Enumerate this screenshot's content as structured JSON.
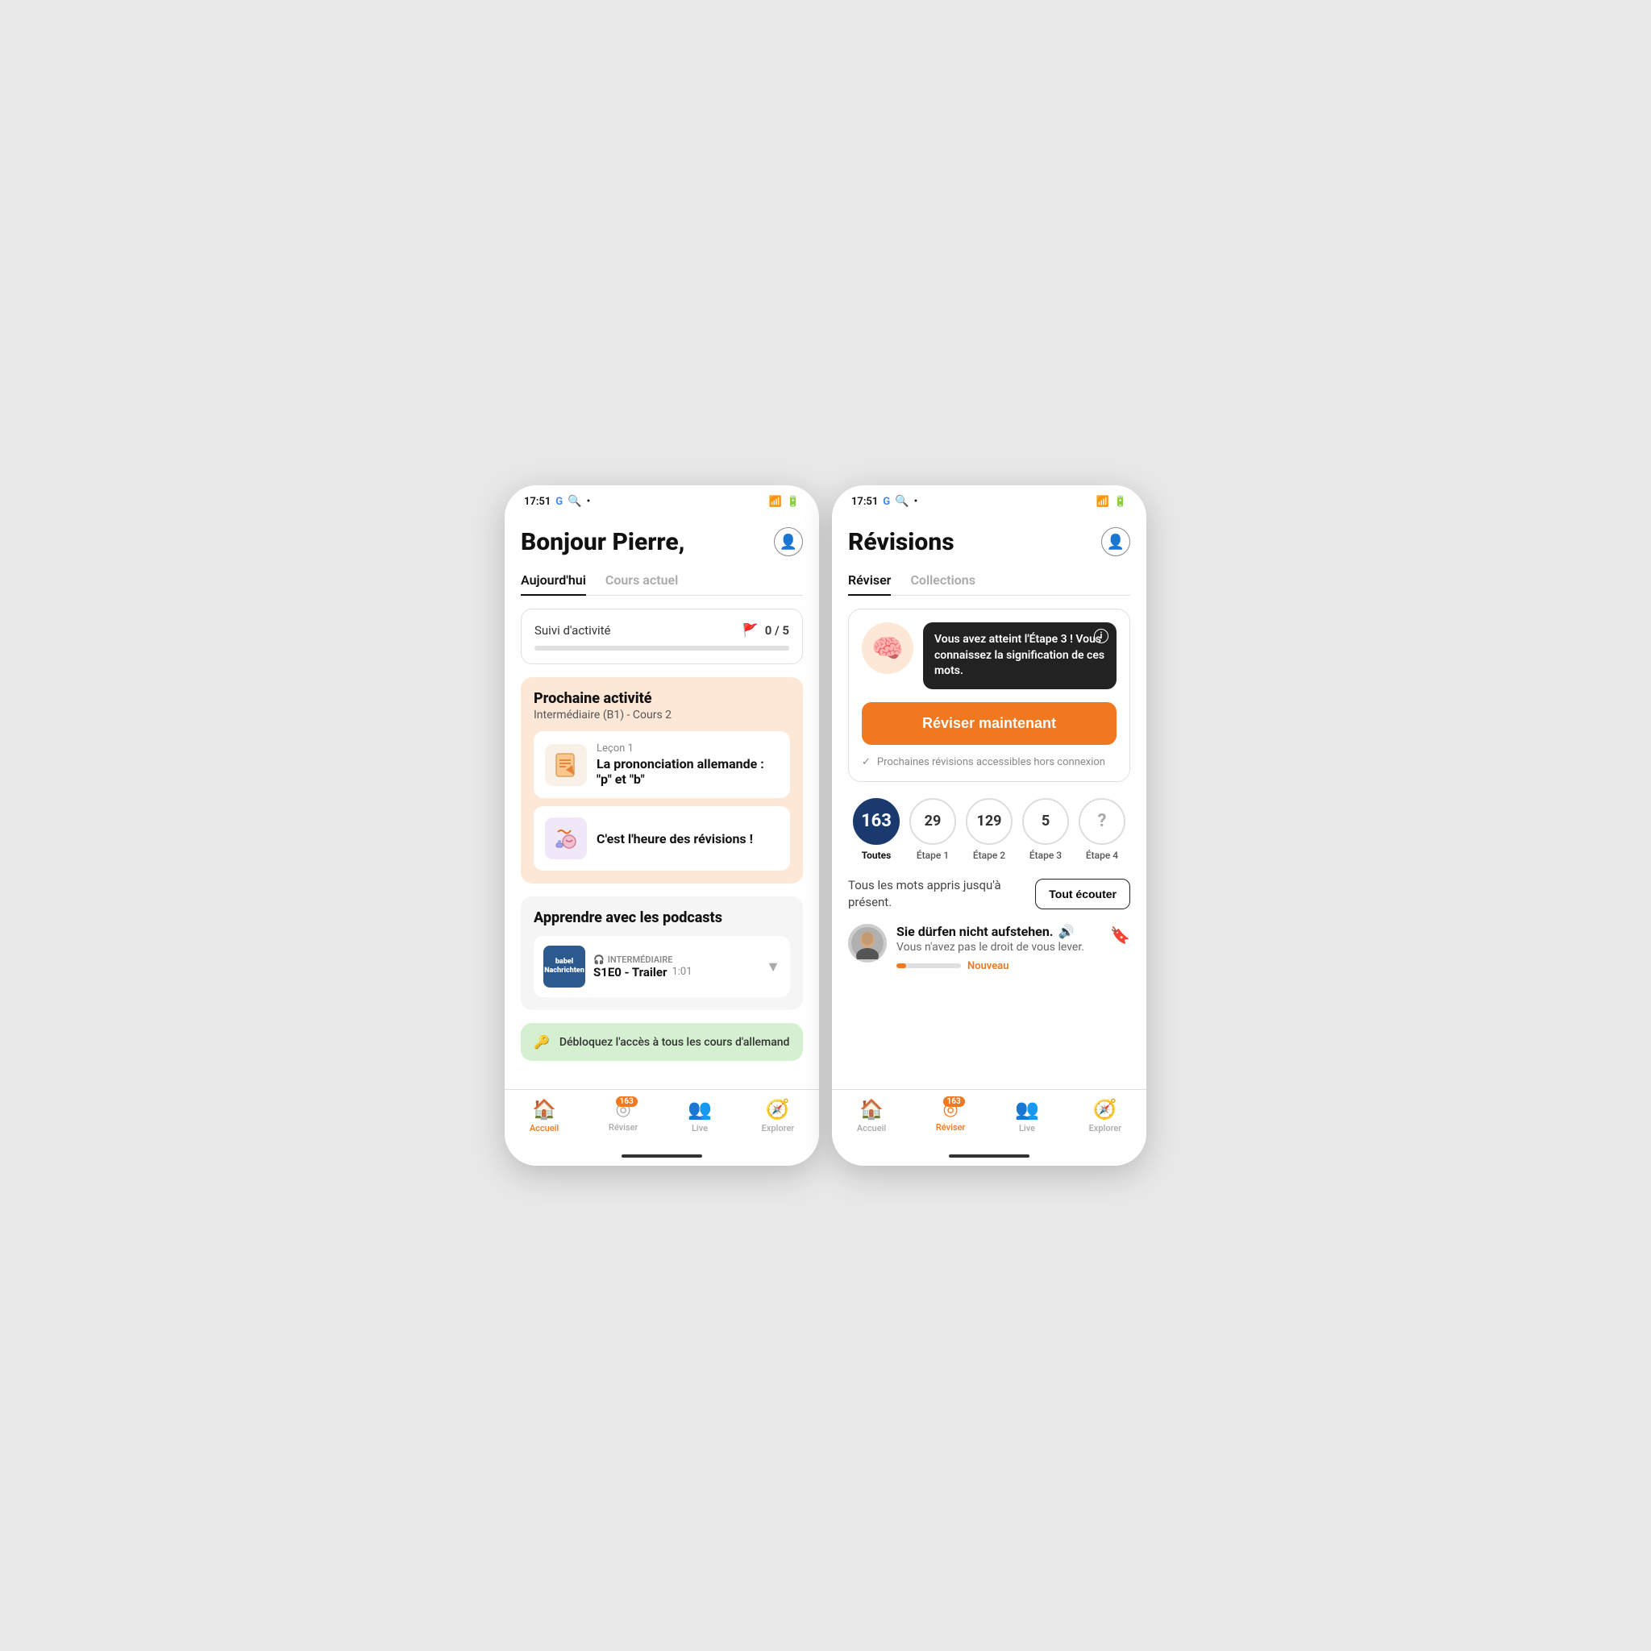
{
  "left_screen": {
    "status_bar": {
      "time": "17:51",
      "google_g": "G",
      "search_icon": "🔍",
      "dot": "•",
      "wifi": "📶",
      "battery": "🔋"
    },
    "header": {
      "title": "Bonjour Pierre,",
      "avatar_label": "profile"
    },
    "tabs": [
      {
        "label": "Aujourd'hui",
        "active": true
      },
      {
        "label": "Cours actuel",
        "active": false
      }
    ],
    "activity_card": {
      "title": "Suivi d'activité",
      "score": "0 / 5",
      "progress": 0
    },
    "next_activity": {
      "title": "Prochaine activité",
      "subtitle": "Intermédiaire (B1) - Cours 2",
      "lesson": {
        "number": "Leçon 1",
        "name": "La prononciation allemande : \"p\" et \"b\""
      },
      "revision": {
        "name": "C'est l'heure des révisions !"
      }
    },
    "podcasts": {
      "title": "Apprendre avec les podcasts",
      "item": {
        "level": "INTERMÉDIAIRE",
        "name": "S1E0 - Trailer",
        "duration": "1:01"
      }
    },
    "unlock_banner": {
      "text": "Débloquez l'accès à tous les cours d'allemand"
    },
    "bottom_nav": [
      {
        "label": "Accueil",
        "icon": "🏠",
        "active": true,
        "badge": null
      },
      {
        "label": "Réviser",
        "icon": "⊙",
        "active": false,
        "badge": "163"
      },
      {
        "label": "Live",
        "icon": "👥",
        "active": false,
        "badge": null
      },
      {
        "label": "Explorer",
        "icon": "🧭",
        "active": false,
        "badge": null
      }
    ]
  },
  "right_screen": {
    "status_bar": {
      "time": "17:51",
      "google_g": "G",
      "search_icon": "🔍",
      "dot": "•",
      "wifi": "📶",
      "battery": "🔋"
    },
    "header": {
      "title": "Révisions",
      "avatar_label": "profile"
    },
    "tabs": [
      {
        "label": "Réviser",
        "active": true
      },
      {
        "label": "Collections",
        "active": false
      }
    ],
    "revisions_card": {
      "brain_emoji": "🧠",
      "tooltip_text": "Vous avez atteint l'Étape 3 ! Vous connaissez la signification de ces mots.",
      "revise_button": "Réviser maintenant",
      "offline_text": "Prochaines révisions accessibles hors connexion"
    },
    "stats": [
      {
        "value": "163",
        "label": "Toutes",
        "active": true
      },
      {
        "value": "29",
        "label": "Étape 1",
        "active": false
      },
      {
        "value": "129",
        "label": "Étape 2",
        "active": false
      },
      {
        "value": "5",
        "label": "Étape 3",
        "active": false
      },
      {
        "value": "?",
        "label": "Étape 4",
        "active": false
      }
    ],
    "words_section": {
      "description": "Tous les mots appris jusqu'à présent.",
      "listen_button": "Tout écouter",
      "word_item": {
        "sentence": "Sie dürfen nicht aufstehen.",
        "translation": "Vous n'avez pas le droit de vous lever.",
        "progress": 15,
        "badge": "Nouveau"
      }
    },
    "bottom_nav": [
      {
        "label": "Accueil",
        "icon": "🏠",
        "active": false,
        "badge": null
      },
      {
        "label": "Réviser",
        "icon": "⊙",
        "active": true,
        "badge": "163"
      },
      {
        "label": "Live",
        "icon": "👥",
        "active": false,
        "badge": null
      },
      {
        "label": "Explorer",
        "icon": "🧭",
        "active": false,
        "badge": null
      }
    ]
  }
}
